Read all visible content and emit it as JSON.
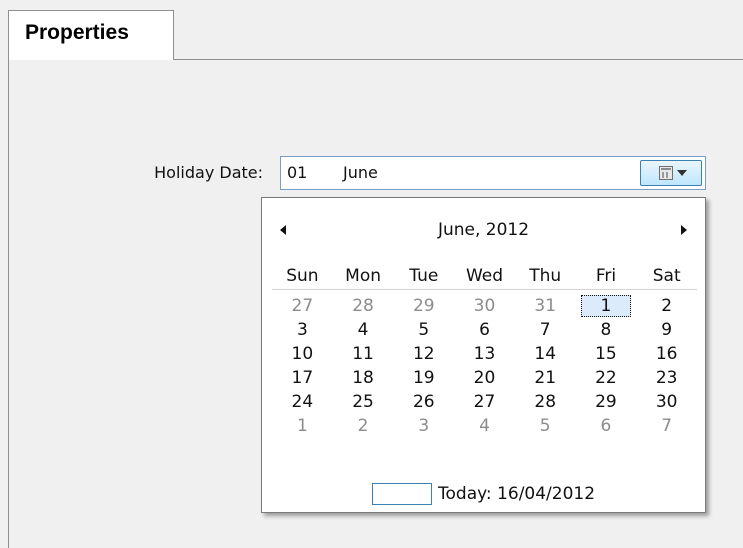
{
  "tabs": [
    {
      "label": "Properties"
    }
  ],
  "form": {
    "holiday_label": "Holiday Date:",
    "date_day": "01",
    "date_month": "June"
  },
  "calendar": {
    "month_title": "June, 2012",
    "weekdays": [
      "Sun",
      "Mon",
      "Tue",
      "Wed",
      "Thu",
      "Fri",
      "Sat"
    ],
    "weeks": [
      [
        "27",
        "28",
        "29",
        "30",
        "31",
        "1",
        "2"
      ],
      [
        "3",
        "4",
        "5",
        "6",
        "7",
        "8",
        "9"
      ],
      [
        "10",
        "11",
        "12",
        "13",
        "14",
        "15",
        "16"
      ],
      [
        "17",
        "18",
        "19",
        "20",
        "21",
        "22",
        "23"
      ],
      [
        "24",
        "25",
        "26",
        "27",
        "28",
        "29",
        "30"
      ],
      [
        "1",
        "2",
        "3",
        "4",
        "5",
        "6",
        "7"
      ]
    ],
    "selected_day": "1",
    "today_text": "Today: 16/04/2012"
  },
  "icons": {
    "prev": "chevron-left-icon",
    "next": "chevron-right-icon",
    "dropdown": "calendar-icon"
  },
  "colors": {
    "input_border": "#7a9cc6",
    "button_border": "#3c7fb1",
    "selected_fill": "#dcebfc",
    "other_month_text": "#8c8c8c"
  }
}
